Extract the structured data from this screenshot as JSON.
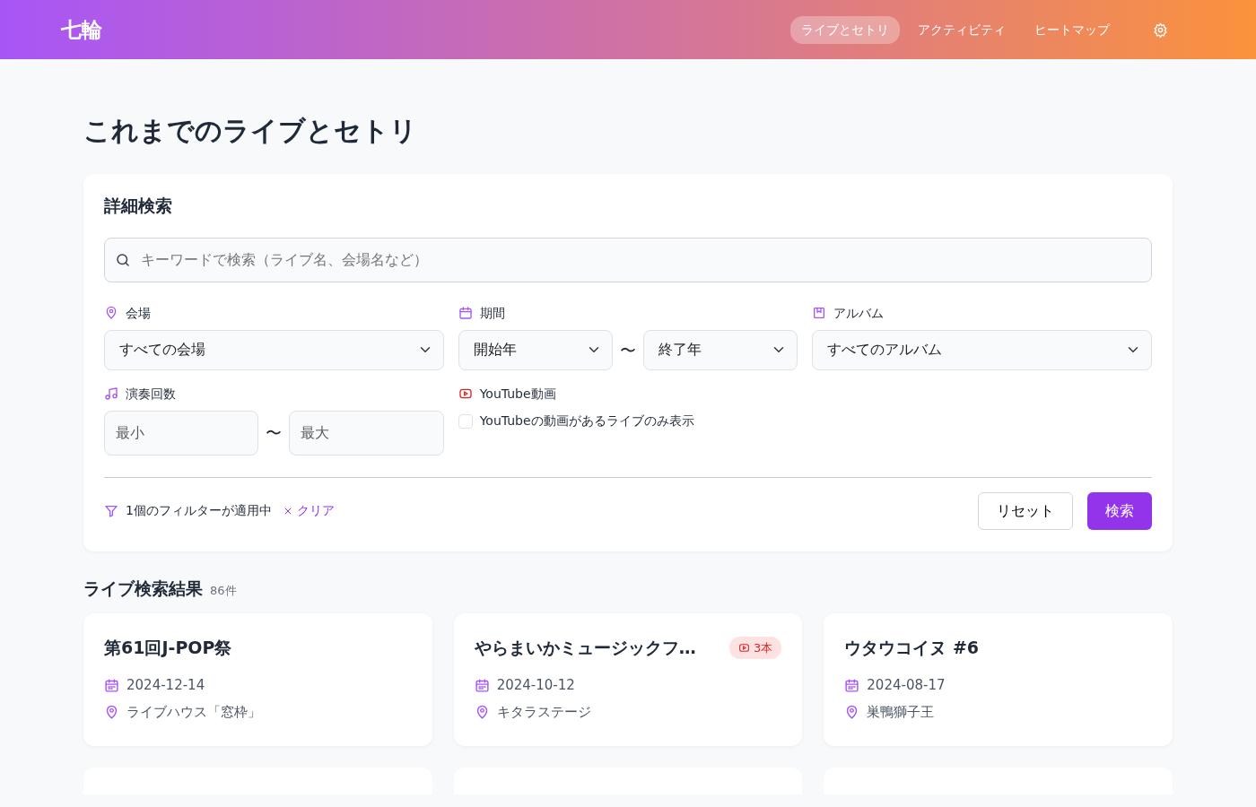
{
  "header": {
    "logo": "七輪",
    "nav": [
      {
        "label": "ライブとセトリ",
        "selected": true
      },
      {
        "label": "アクティビティ",
        "selected": false
      },
      {
        "label": "ヒートマップ",
        "selected": false
      }
    ]
  },
  "page_title": "これまでのライブとセトリ",
  "search_panel": {
    "title": "詳細検索",
    "keyword": {
      "placeholder": "キーワードで検索（ライブ名、会場名など）"
    },
    "filters": [
      {
        "kind": "select",
        "label": "会場",
        "values": [
          "すべての会場"
        ]
      },
      {
        "kind": "range-select",
        "label": "期間",
        "values": [
          "開始年",
          "終了年"
        ],
        "separator": "〜"
      },
      {
        "kind": "select",
        "label": "アルバム",
        "values": [
          "すべてのアルバム"
        ]
      },
      {
        "kind": "range-input",
        "label": "演奏回数",
        "placeholders": [
          "最小",
          "最大"
        ],
        "separator": "〜"
      },
      {
        "kind": "checkbox",
        "label": "YouTube動画",
        "option": "YouTubeの動画があるライブのみ表示",
        "checked": false
      }
    ],
    "status": "1個のフィルターが適用中",
    "clear": "クリア",
    "buttons": [
      "リセット",
      "検索"
    ]
  },
  "results": {
    "title": "ライブ検索結果",
    "count": "86件",
    "lives": [
      {
        "title": "第61回J-POP祭",
        "date": "2024-12-14",
        "venue": "ライブハウス「窓枠」"
      },
      {
        "title": "やらまいかミュージックフ…",
        "date": "2024-10-12",
        "venue": "キタラステージ",
        "youtube": "3本"
      },
      {
        "title": "ウタウコイヌ #6",
        "date": "2024-08-17",
        "venue": "巣鴨獅子王"
      },
      {
        "kind": "cut"
      },
      {
        "kind": "cut"
      },
      {
        "kind": "cut"
      }
    ]
  }
}
